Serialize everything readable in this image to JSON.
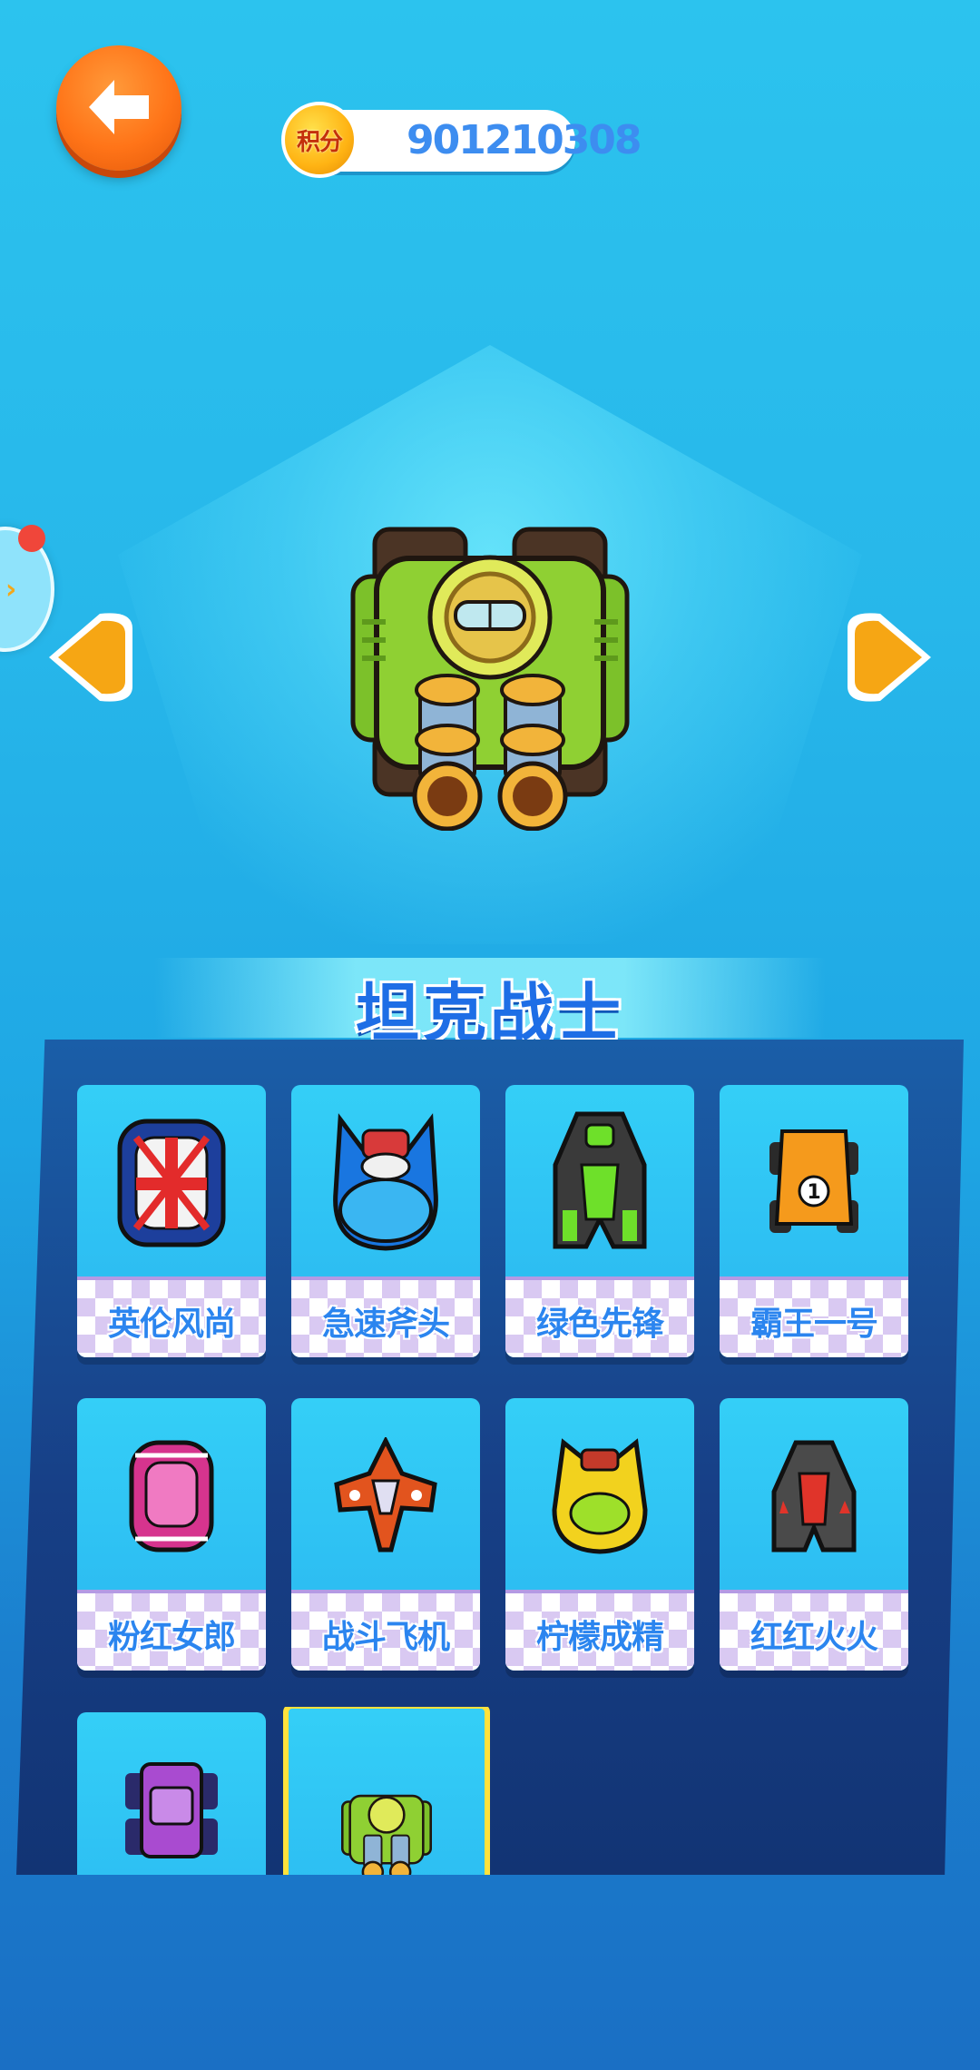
{
  "header": {
    "score_label": "积分",
    "score_value": "901210308"
  },
  "hero": {
    "vehicle_name": "坦克战士"
  },
  "vehicles": [
    {
      "name": "英伦风尚",
      "icon": "union-jack-car-icon"
    },
    {
      "name": "急速斧头",
      "icon": "blue-racer-icon"
    },
    {
      "name": "绿色先锋",
      "icon": "green-racer-icon"
    },
    {
      "name": "霸王一号",
      "icon": "orange-kart-icon"
    },
    {
      "name": "粉红女郎",
      "icon": "pink-car-icon"
    },
    {
      "name": "战斗飞机",
      "icon": "fighter-plane-icon"
    },
    {
      "name": "柠檬成精",
      "icon": "yellow-racer-icon"
    },
    {
      "name": "红红火火",
      "icon": "red-racer-icon"
    },
    {
      "name": "",
      "icon": "purple-truck-icon"
    },
    {
      "name": "",
      "icon": "green-tank-icon",
      "selected": true
    }
  ],
  "colors": {
    "accent": "#ff7418",
    "title": "#1e6ee6",
    "selection": "#ffe23c"
  }
}
